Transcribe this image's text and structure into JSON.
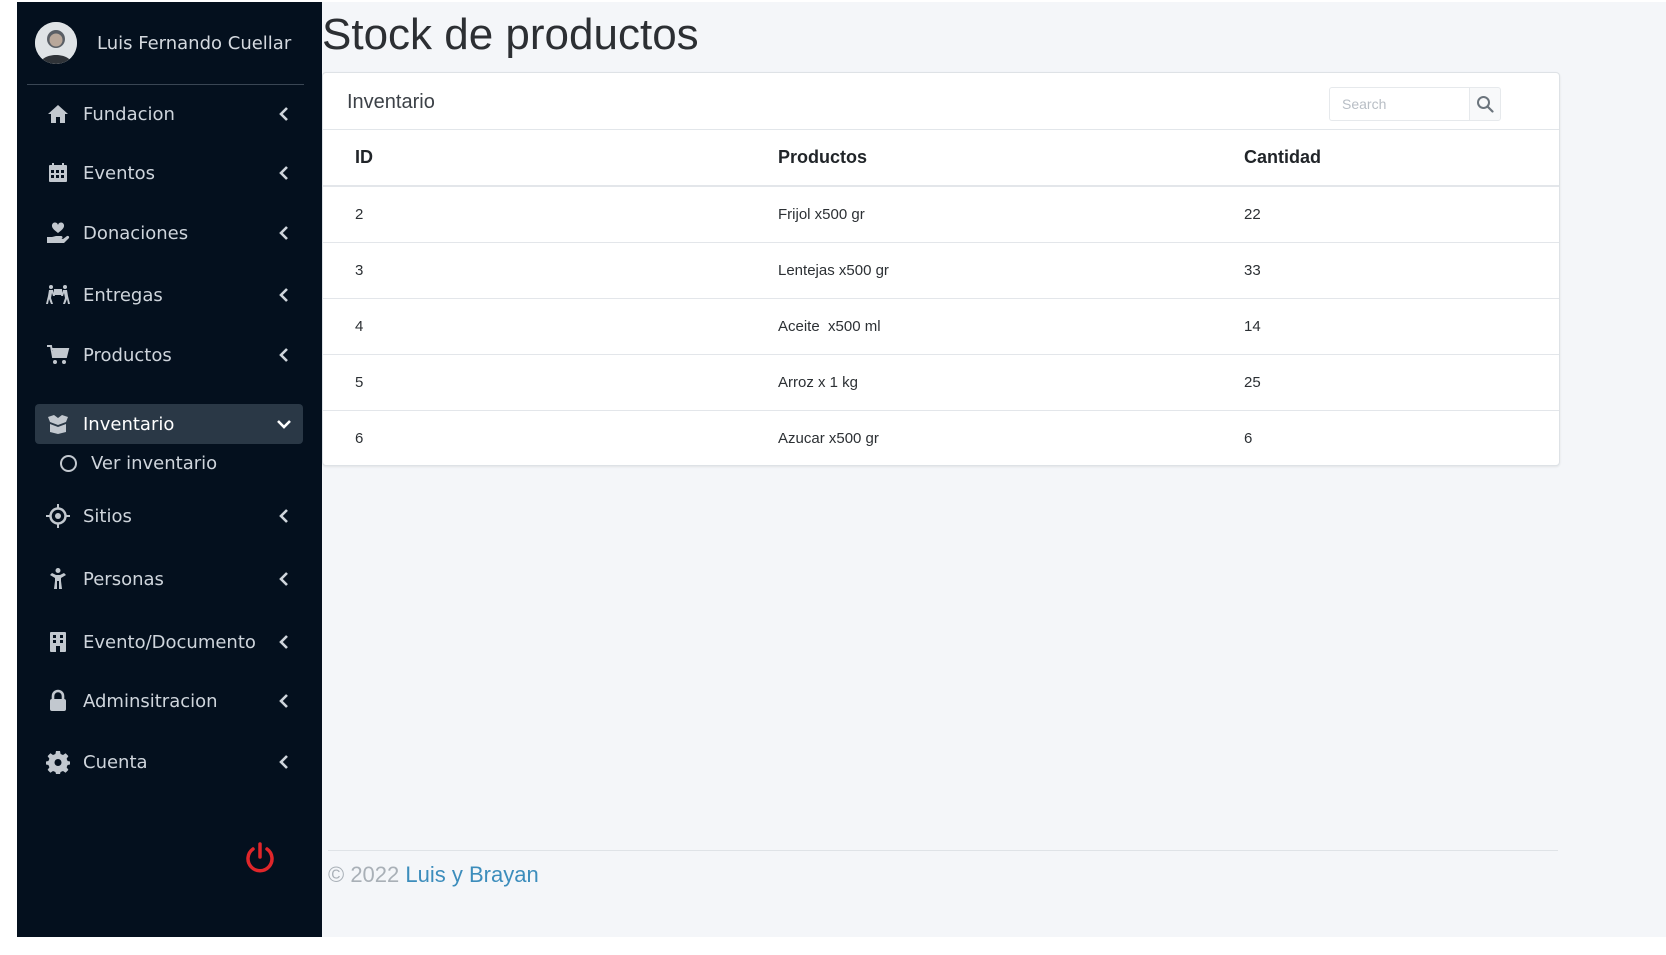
{
  "user": {
    "name": "Luis Fernando Cuellar"
  },
  "sidebar": {
    "items": [
      {
        "label": "Fundacion",
        "icon": "home-icon"
      },
      {
        "label": "Eventos",
        "icon": "calendar-icon"
      },
      {
        "label": "Donaciones",
        "icon": "hand-holding-heart-icon"
      },
      {
        "label": "Entregas",
        "icon": "people-carry-icon"
      },
      {
        "label": "Productos",
        "icon": "cart-icon"
      },
      {
        "label": "Inventario",
        "icon": "box-open-icon",
        "expanded": true
      },
      {
        "label": "Sitios",
        "icon": "crosshairs-icon"
      },
      {
        "label": "Personas",
        "icon": "child-icon"
      },
      {
        "label": "Evento/Documento",
        "icon": "building-icon"
      },
      {
        "label": "Adminsitracion",
        "icon": "lock-icon"
      },
      {
        "label": "Cuenta",
        "icon": "cog-icon"
      }
    ],
    "subitems": [
      {
        "label": "Ver inventario"
      }
    ],
    "power_icon": "power-off-icon",
    "power_color": "#e0262a"
  },
  "main": {
    "title": "Stock de productos",
    "card": {
      "title": "Inventario",
      "search_placeholder": "Search",
      "columns": [
        "ID",
        "Productos",
        "Cantidad"
      ],
      "rows": [
        [
          "2",
          "Frijol x500 gr",
          "22"
        ],
        [
          "3",
          "Lentejas x500 gr",
          "33"
        ],
        [
          "4",
          "Aceite  x500 ml",
          "14"
        ],
        [
          "5",
          "Arroz x 1 kg",
          "25"
        ],
        [
          "6",
          "Azucar x500 gr",
          "6"
        ]
      ]
    }
  },
  "footer": {
    "copyright": "© 2022",
    "link_text": "Luis y Brayan",
    "link_color": "#3c8dbc"
  }
}
